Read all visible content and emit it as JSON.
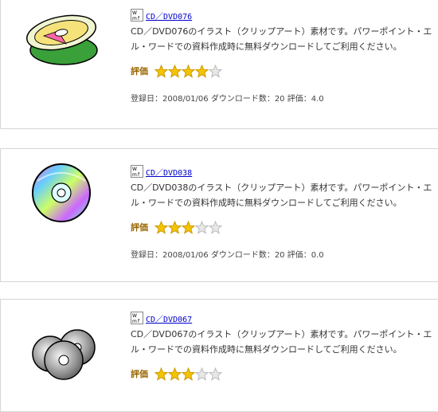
{
  "items": [
    {
      "title": "CD／DVD076",
      "desc_line1": "CD／DVD076のイラスト（クリップアート）素材です。パワーポイント・エ",
      "desc_line2": "ル・ワードでの資料作成時に無料ダウンロードしてご利用ください。",
      "rating_label": "評価",
      "rating": 4,
      "meta": "登録日：2008/01/06 ダウンロード数：20 評価：4.0"
    },
    {
      "title": "CD／DVD038",
      "desc_line1": "CD／DVD038のイラスト（クリップアート）素材です。パワーポイント・エ",
      "desc_line2": "ル・ワードでの資料作成時に無料ダウンロードしてご利用ください。",
      "rating_label": "評価",
      "rating": 3,
      "meta": "登録日：2008/01/06 ダウンロード数：20 評価：0.0"
    },
    {
      "title": "CD／DVD067",
      "desc_line1": "CD／DVD067のイラスト（クリップアート）素材です。パワーポイント・エ",
      "desc_line2": "ル・ワードでの資料作成時に無料ダウンロードしてご利用ください。",
      "rating_label": "評価",
      "rating": 3
    }
  ],
  "colors": {
    "star_fill": "#f5c400",
    "star_stroke": "#c99a00",
    "star_empty": "#e8e8e8",
    "link": "#0000cc",
    "rating_label": "#996600"
  }
}
